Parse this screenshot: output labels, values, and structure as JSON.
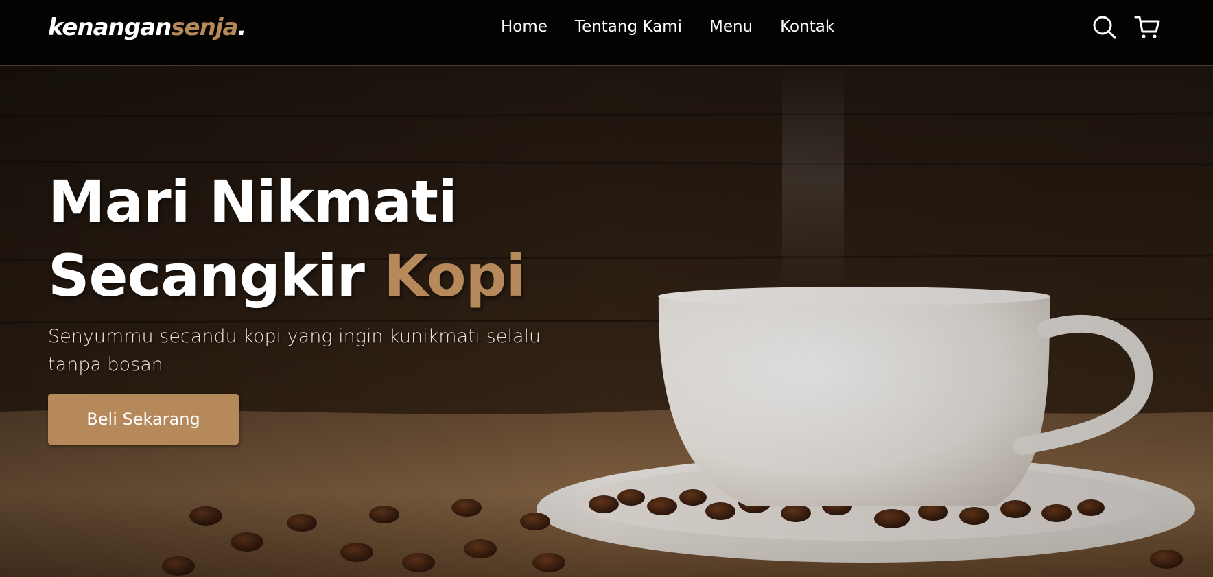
{
  "brand": {
    "logo_main": "kenangan",
    "logo_accent": "senja",
    "logo_dot": ".",
    "accent_color": "#b6895b"
  },
  "nav": {
    "links": [
      {
        "label": "Home"
      },
      {
        "label": "Tentang Kami"
      },
      {
        "label": "Menu"
      },
      {
        "label": "Kontak"
      }
    ],
    "icons": [
      "search-icon",
      "shopping-cart-icon"
    ]
  },
  "hero": {
    "title_line1": "Mari Nikmati",
    "title_line2_main": "Secangkir",
    "title_line2_accent": "Kopi",
    "subtitle": "Senyummu secandu kopi yang ingin kunikmati selalu tanpa bosan",
    "cta_label": "Beli Sekarang",
    "background_image": "coffee-cup-with-beans"
  }
}
